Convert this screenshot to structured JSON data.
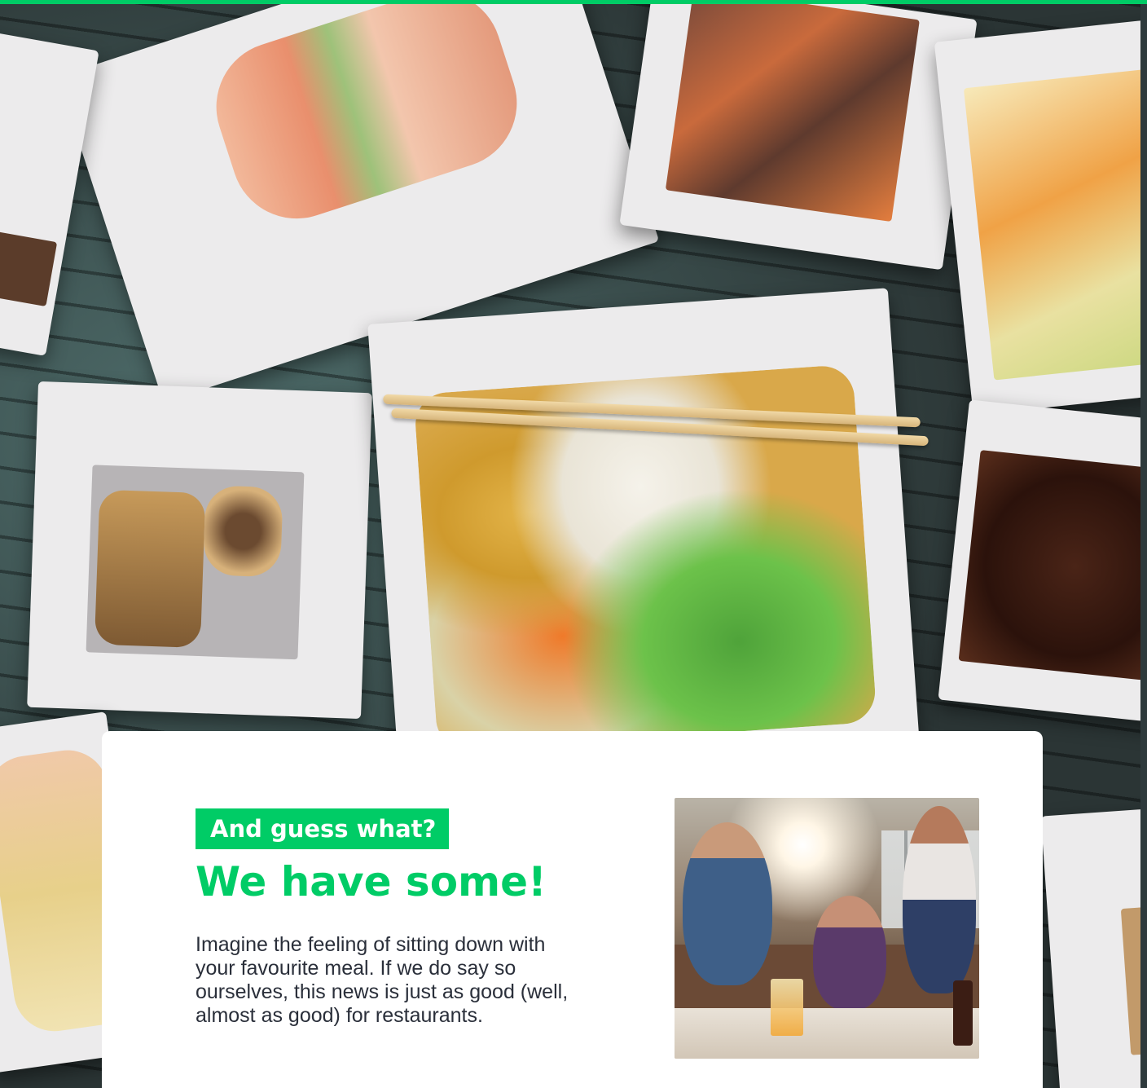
{
  "hero": {
    "image_alt": "Assorted takeaway food boxes on a wooden table"
  },
  "promo": {
    "eyebrow": "And guess what?",
    "headline": "We have some!",
    "body": "Imagine the feeling of sitting down with your favourite meal. If we do say so ourselves, this news is just as good (well, almost as good) for restaurants.",
    "photo_alt": "Friends eating together on a sofa"
  },
  "colors": {
    "accent": "#00cc66",
    "text": "#2a2f3a",
    "card_bg": "#ffffff"
  }
}
